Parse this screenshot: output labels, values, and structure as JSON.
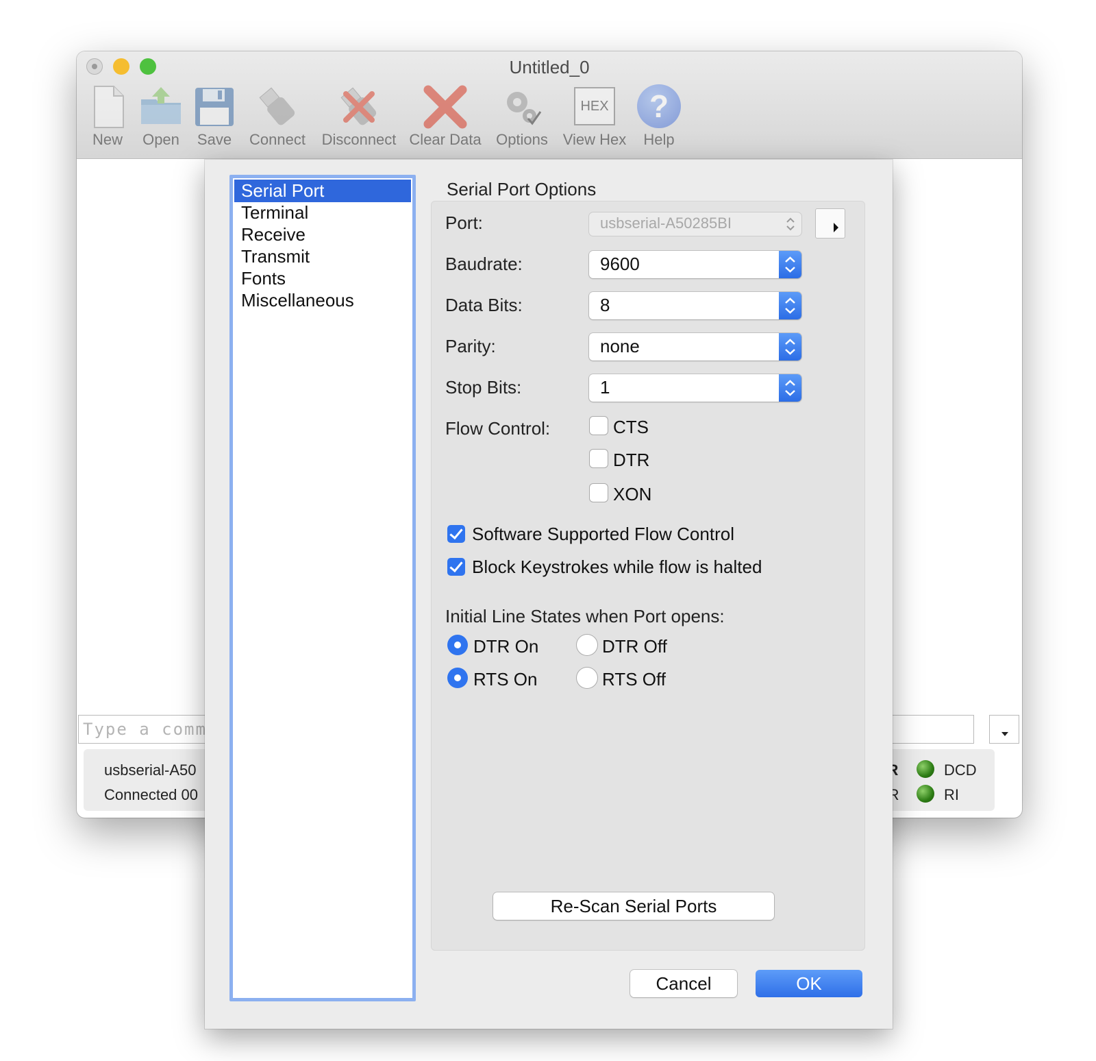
{
  "window": {
    "title": "Untitled_0",
    "toolbar": [
      {
        "key": "new",
        "label": "New",
        "icon": "new-document-icon"
      },
      {
        "key": "open",
        "label": "Open",
        "icon": "folder-open-icon"
      },
      {
        "key": "save",
        "label": "Save",
        "icon": "floppy-disk-icon"
      },
      {
        "key": "connect",
        "label": "Connect",
        "icon": "usb-plug-icon"
      },
      {
        "key": "disconnect",
        "label": "Disconnect",
        "icon": "usb-plug-cross-icon"
      },
      {
        "key": "clear",
        "label": "Clear Data",
        "icon": "red-x-icon"
      },
      {
        "key": "options",
        "label": "Options",
        "icon": "gears-icon"
      },
      {
        "key": "viewhex",
        "label": "View Hex",
        "icon": "hex-icon",
        "icon_text": "HEX"
      },
      {
        "key": "help",
        "label": "Help",
        "icon": "question-mark-icon",
        "icon_text": "?"
      }
    ],
    "command_placeholder": "Type a commar",
    "status": {
      "port": "usbserial-A50",
      "connection": "Connected 00",
      "line_left_top": "TR",
      "line_left_bottom": "SR",
      "indicators": [
        "DCD",
        "RI"
      ],
      "indicator_color": "#2d7d15"
    }
  },
  "dialog": {
    "categories": [
      "Serial Port",
      "Terminal",
      "Receive",
      "Transmit",
      "Fonts",
      "Miscellaneous"
    ],
    "selected_category": "Serial Port",
    "section_title": "Serial Port Options",
    "port": {
      "label": "Port:",
      "value": "usbserial-A50285BI"
    },
    "baudrate": {
      "label": "Baudrate:",
      "value": "9600"
    },
    "data_bits": {
      "label": "Data Bits:",
      "value": "8"
    },
    "parity": {
      "label": "Parity:",
      "value": "none"
    },
    "stop_bits": {
      "label": "Stop Bits:",
      "value": "1"
    },
    "flow_control": {
      "label": "Flow Control:",
      "options": [
        {
          "label": "CTS",
          "checked": false
        },
        {
          "label": "DTR",
          "checked": false
        },
        {
          "label": "XON",
          "checked": false
        }
      ]
    },
    "software_flow": {
      "label": "Software Supported Flow Control",
      "checked": true
    },
    "block_keystrokes": {
      "label": "Block Keystrokes while flow is halted",
      "checked": true
    },
    "line_states": {
      "title": "Initial Line States when Port opens:",
      "dtr_on": "DTR On",
      "dtr_off": "DTR Off",
      "rts_on": "RTS On",
      "rts_off": "RTS Off",
      "dtr_selected": "DTR On",
      "rts_selected": "RTS On"
    },
    "rescan_label": "Re-Scan Serial Ports",
    "cancel_label": "Cancel",
    "ok_label": "OK",
    "accent_color": "#2f74ef"
  }
}
